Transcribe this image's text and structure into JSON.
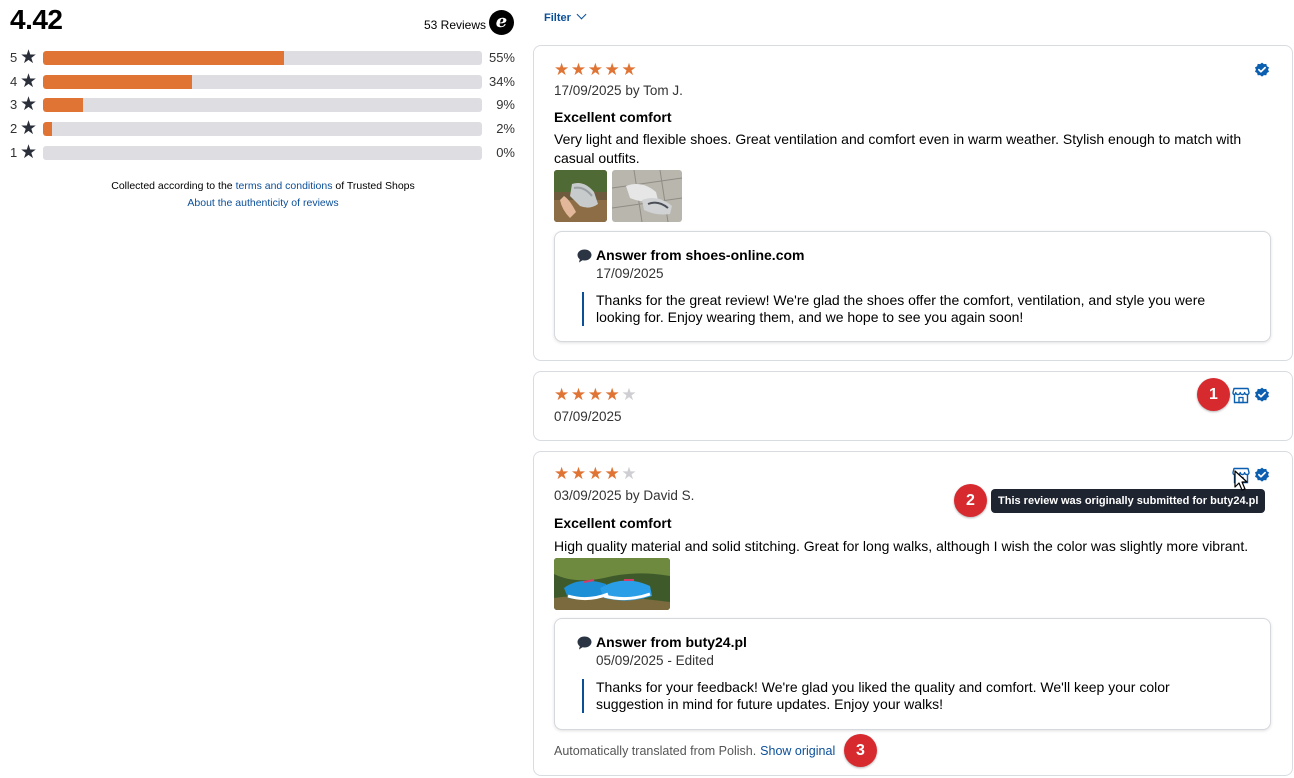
{
  "summary": {
    "average": "4.42",
    "review_count": "53 Reviews",
    "logo": "e",
    "distribution": [
      {
        "stars": "5",
        "percent": 55,
        "label": "55%"
      },
      {
        "stars": "4",
        "percent": 34,
        "label": "34%"
      },
      {
        "stars": "3",
        "percent": 9,
        "label": "9%"
      },
      {
        "stars": "2",
        "percent": 2,
        "label": "2%"
      },
      {
        "stars": "1",
        "percent": 0,
        "label": "0%"
      }
    ],
    "collected_prefix": "Collected according to the",
    "collected_link": "terms and conditions",
    "collected_suffix": "of Trusted Shops",
    "authenticity_link": "About the authenticity of reviews"
  },
  "filter": {
    "label": "Filter"
  },
  "reviews": [
    {
      "rating": 5,
      "meta": "17/09/2025 by Tom J.",
      "title": "Excellent comfort",
      "text": "Very light and flexible shoes. Great ventilation and comfort even in warm weather. Stylish enough to match with casual outfits.",
      "answer": {
        "title": "Answer from shoes-online.com",
        "date": "17/09/2025",
        "text": "Thanks for the great review! We're glad the shoes offer the comfort, ventilation, and style you were looking for. Enjoy wearing them, and we hope to see you again soon!"
      }
    },
    {
      "rating": 4,
      "meta": "07/09/2025"
    },
    {
      "rating": 4,
      "meta": "03/09/2025 by David S.",
      "title": "Excellent comfort",
      "text": "High quality material and solid stitching. Great for long walks, although I wish the color was slightly more vibrant.",
      "answer": {
        "title": "Answer from buty24.pl",
        "date": "05/09/2025 - Edited",
        "text": "Thanks for your feedback! We're glad you liked the quality and comfort. We'll keep your color suggestion in mind for future updates. Enjoy your walks!"
      },
      "translated_text": "Automatically translated from Polish.",
      "show_original": "Show original"
    }
  ],
  "tooltip": "This review was originally submitted for buty24.pl",
  "markers": [
    "1",
    "2",
    "3"
  ],
  "colors": {
    "star": "#e07435",
    "link": "#0b4f99",
    "marker": "#d62a2f",
    "tooltip_bg": "#1e2430"
  },
  "icons": [
    "star-icon",
    "verified-badge-icon",
    "shop-icon",
    "speech-bubble-icon",
    "chevron-down-icon",
    "mouse-pointer-icon",
    "trusted-shops-logo"
  ]
}
